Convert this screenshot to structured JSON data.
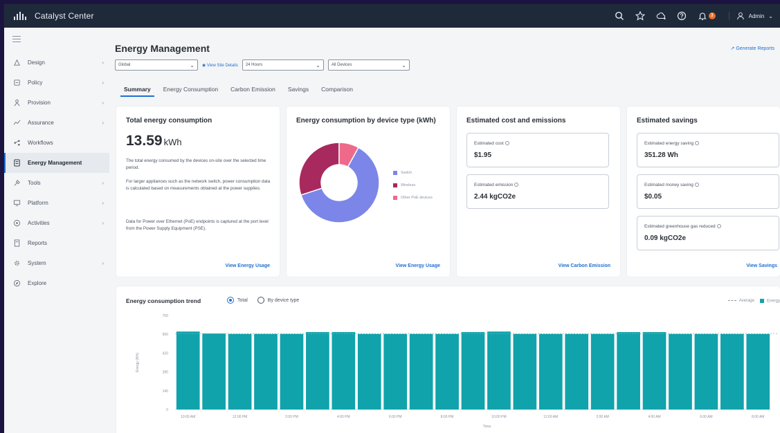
{
  "app": {
    "title": "Catalyst Center",
    "user": "Admin",
    "notification_count": "3"
  },
  "colors": {
    "topbar": "#1e2a3a",
    "accent": "#1f6fd1",
    "bar": "#10a3ab",
    "switch": "#7b86e8",
    "wireless": "#a8295e",
    "other_poe": "#ee6a8a"
  },
  "sidebar": {
    "items": [
      {
        "label": "Design",
        "icon": "design-icon",
        "chevron": true
      },
      {
        "label": "Policy",
        "icon": "policy-icon",
        "chevron": true
      },
      {
        "label": "Provision",
        "icon": "provision-icon",
        "chevron": true
      },
      {
        "label": "Assurance",
        "icon": "assurance-icon",
        "chevron": true
      },
      {
        "label": "Workflows",
        "icon": "workflows-icon",
        "chevron": false
      },
      {
        "label": "Energy Management",
        "icon": "energy-icon",
        "chevron": false,
        "active": true
      },
      {
        "label": "Tools",
        "icon": "tools-icon",
        "chevron": true
      },
      {
        "label": "Platform",
        "icon": "platform-icon",
        "chevron": true
      },
      {
        "label": "Activities",
        "icon": "activities-icon",
        "chevron": true
      },
      {
        "label": "Reports",
        "icon": "reports-icon",
        "chevron": false
      },
      {
        "label": "System",
        "icon": "system-icon",
        "chevron": true
      },
      {
        "label": "Explore",
        "icon": "explore-icon",
        "chevron": false
      }
    ]
  },
  "page": {
    "title": "Energy Management",
    "generate_reports": "Generate Reports",
    "filters": {
      "site": "Global",
      "view_site_details": "View Site Details",
      "time": "24 Hours",
      "devices": "All Devices"
    },
    "tabs": [
      "Summary",
      "Energy Consumption",
      "Carbon Emission",
      "Savings",
      "Comparison"
    ]
  },
  "total_card": {
    "title": "Total energy consumption",
    "value": "13.59",
    "unit": "kWh",
    "p1": "The total energy consumed by the devices on-site over the selected time period.",
    "p2": "For larger appliances such as the network switch, power consumption data is calculated based on measurements obtained at the power supplies.",
    "p3": "Data for Power over Ethernet (PoE) endpoints is captured at the port level from the Power Supply Equipment (PSE).",
    "link": "View Energy Usage"
  },
  "device_card": {
    "title": "Energy consumption by device type (kWh)",
    "legend": [
      "Switch",
      "Wireless",
      "Other PoE devices"
    ],
    "link": "View Energy Usage"
  },
  "cost_card": {
    "title": "Estimated cost and emissions",
    "cost_label": "Estimated cost",
    "cost_value": "$1.95",
    "emission_label": "Estimated emission",
    "emission_value": "2.44 kgCO2e",
    "link": "View Carbon Emission"
  },
  "savings_card": {
    "title": "Estimated savings",
    "energy_label": "Estimated energy saving",
    "energy_value": "351.28 Wh",
    "money_label": "Estimated money saving",
    "money_value": "$0.05",
    "ghg_label": "Estimated greenhouse gas reduced",
    "ghg_value": "0.09 kgCO2e",
    "link": "View Savings"
  },
  "trend": {
    "title": "Energy consumption trend",
    "radio_total": "Total",
    "radio_device": "By device type",
    "legend_average": "Average",
    "legend_energy": "Energy"
  },
  "chart_data": [
    {
      "type": "pie",
      "title": "Energy consumption by device type (kWh)",
      "donut": true,
      "categories": [
        "Switch",
        "Wireless",
        "Other PoE devices"
      ],
      "values": [
        62,
        30,
        8
      ]
    },
    {
      "type": "bar",
      "title": "Energy consumption trend",
      "xlabel": "Time",
      "ylabel": "Energy (Wh)",
      "yticks": [
        "0",
        "140",
        "280",
        "420",
        "560",
        "700"
      ],
      "ylim": [
        0,
        700
      ],
      "xticks": [
        "10:00 AM",
        "12:00 PM",
        "2:00 PM",
        "4:00 PM",
        "6:00 PM",
        "8:00 PM",
        "10:00 PM",
        "12:00 AM",
        "2:00 AM",
        "4:00 AM",
        "6:00 AM",
        "8:00 AM"
      ],
      "values": [
        580,
        565,
        562,
        562,
        562,
        576,
        576,
        562,
        562,
        562,
        562,
        576,
        580,
        562,
        562,
        562,
        562,
        576,
        576,
        562,
        562,
        562,
        562
      ],
      "average": 565
    }
  ]
}
